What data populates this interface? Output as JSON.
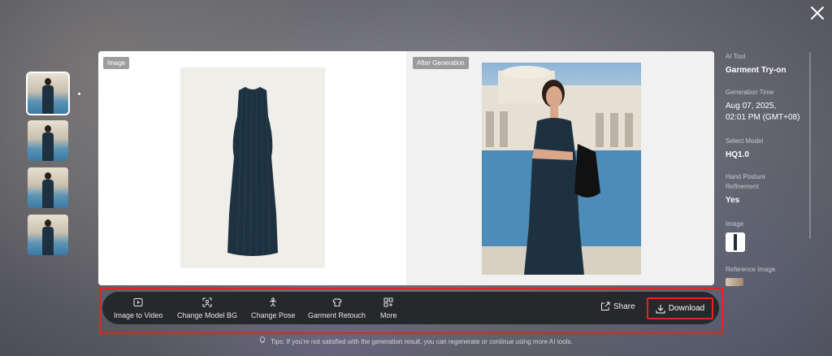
{
  "thumbnails": [
    {
      "label": "result-1",
      "active": true
    },
    {
      "label": "result-2",
      "active": false
    },
    {
      "label": "result-3",
      "active": false
    },
    {
      "label": "result-4",
      "active": false
    }
  ],
  "panes": {
    "left_tag": "Image",
    "right_tag": "After Generation"
  },
  "toolbar": {
    "tools": [
      {
        "label": "Image to Video",
        "icon": "video-icon"
      },
      {
        "label": "Change Model BG",
        "icon": "background-icon"
      },
      {
        "label": "Change Pose",
        "icon": "pose-icon"
      },
      {
        "label": "Garment Retouch",
        "icon": "retouch-icon"
      },
      {
        "label": "More",
        "icon": "more-grid-icon"
      }
    ],
    "share_label": "Share",
    "download_label": "Download"
  },
  "tips": "Tips: If you're not satisfied with the generation result, you can regenerate or continue using more AI tools.",
  "info": {
    "ai_tool_label": "AI Tool",
    "ai_tool_value": "Garment Try-on",
    "generation_time_label": "Generation Time",
    "generation_time_line1": "Aug 07, 2025,",
    "generation_time_line2": "02:01 PM (GMT+08)",
    "select_model_label": "Select Model",
    "select_model_value": "HQ1.0",
    "hand_posture_label_line1": "Hand Posture",
    "hand_posture_label_line2": "Refinement",
    "hand_posture_value": "Yes",
    "image_label": "Image",
    "reference_image_label": "Reference Image"
  },
  "colors": {
    "highlight": "#e0251f",
    "toolbar_bg": "#27282b",
    "dress": "#1d3140"
  }
}
